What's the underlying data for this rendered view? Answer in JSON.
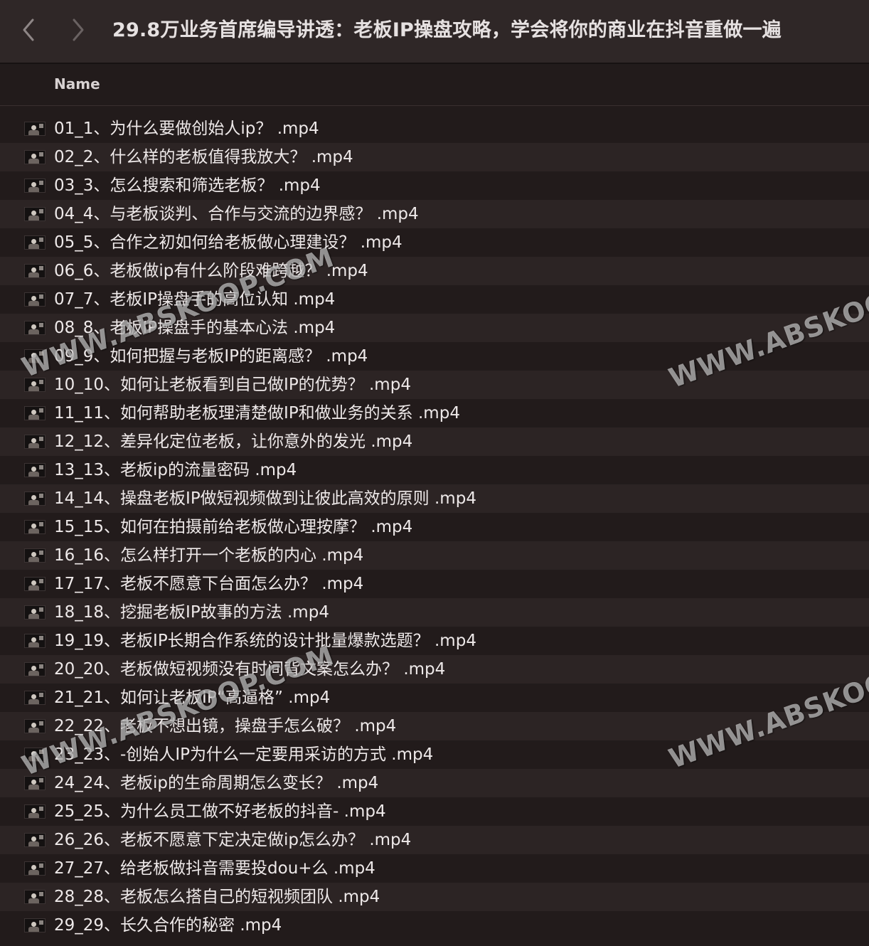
{
  "window": {
    "title": "29.8万业务首席编导讲透：老板IP操盘攻略，学会将你的商业在抖音重做一遍",
    "back_icon": "chevron-left-icon",
    "forward_icon": "chevron-right-icon"
  },
  "list": {
    "column_header": "Name",
    "files": [
      {
        "name": "01_1、为什么要做创始人ip？ .mp4",
        "icon": "video-thumbnail-icon"
      },
      {
        "name": "02_2、什么样的老板值得我放大？ .mp4",
        "icon": "video-thumbnail-icon"
      },
      {
        "name": "03_3、怎么搜索和筛选老板？ .mp4",
        "icon": "video-thumbnail-icon"
      },
      {
        "name": "04_4、与老板谈判、合作与交流的边界感？ .mp4",
        "icon": "video-thumbnail-icon"
      },
      {
        "name": "05_5、合作之初如何给老板做心理建设？ .mp4",
        "icon": "video-thumbnail-icon"
      },
      {
        "name": "06_6、老板做ip有什么阶段难跨越？ .mp4",
        "icon": "video-thumbnail-icon"
      },
      {
        "name": "07_7、老板IP操盘手的高位认知 .mp4",
        "icon": "video-thumbnail-icon"
      },
      {
        "name": "08_8、老板IP操盘手的基本心法 .mp4",
        "icon": "video-thumbnail-icon"
      },
      {
        "name": "09_9、如何把握与老板IP的距离感？ .mp4",
        "icon": "video-thumbnail-icon"
      },
      {
        "name": "10_10、如何让老板看到自己做IP的优势？ .mp4",
        "icon": "video-thumbnail-icon"
      },
      {
        "name": "11_11、如何帮助老板理清楚做IP和做业务的关系 .mp4",
        "icon": "video-thumbnail-icon"
      },
      {
        "name": "12_12、差异化定位老板，让你意外的发光 .mp4",
        "icon": "video-thumbnail-icon"
      },
      {
        "name": "13_13、老板ip的流量密码 .mp4",
        "icon": "video-thumbnail-icon"
      },
      {
        "name": "14_14、操盘老板IP做短视频做到让彼此高效的原则 .mp4",
        "icon": "video-thumbnail-icon"
      },
      {
        "name": "15_15、如何在拍摄前给老板做心理按摩？ .mp4",
        "icon": "video-thumbnail-icon"
      },
      {
        "name": "16_16、怎么样打开一个老板的内心 .mp4",
        "icon": "video-thumbnail-icon"
      },
      {
        "name": "17_17、老板不愿意下台面怎么办？ .mp4",
        "icon": "video-thumbnail-icon"
      },
      {
        "name": "18_18、挖掘老板IP故事的方法 .mp4",
        "icon": "video-thumbnail-icon"
      },
      {
        "name": "19_19、老板IP长期合作系统的设计批量爆款选题？ .mp4",
        "icon": "video-thumbnail-icon"
      },
      {
        "name": "20_20、老板做短视频没有时间背文案怎么办？ .mp4",
        "icon": "video-thumbnail-icon"
      },
      {
        "name": "21_21、如何让老板IP“高逼格” .mp4",
        "icon": "video-thumbnail-icon"
      },
      {
        "name": "22_22、老板不想出镜，操盘手怎么破？ .mp4",
        "icon": "video-thumbnail-icon"
      },
      {
        "name": "23_23、-创始人IP为什么一定要用采访的方式 .mp4",
        "icon": "video-thumbnail-icon"
      },
      {
        "name": "24_24、老板ip的生命周期怎么变长？ .mp4",
        "icon": "video-thumbnail-icon"
      },
      {
        "name": "25_25、为什么员工做不好老板的抖音- .mp4",
        "icon": "video-thumbnail-icon"
      },
      {
        "name": "26_26、老板不愿意下定决定做ip怎么办？ .mp4",
        "icon": "video-thumbnail-icon"
      },
      {
        "name": "27_27、给老板做抖音需要投dou+么 .mp4",
        "icon": "video-thumbnail-icon"
      },
      {
        "name": "28_28、老板怎么搭自己的短视频团队 .mp4",
        "icon": "video-thumbnail-icon"
      },
      {
        "name": "29_29、长久合作的秘密 .mp4",
        "icon": "video-thumbnail-icon"
      }
    ]
  },
  "watermarks": [
    {
      "text": "WWW.ABSKOOP.COM"
    },
    {
      "text": "WWW.ABSKOOP.COM"
    },
    {
      "text": "WWW.ABSKOOP.COM"
    },
    {
      "text": "WWW.ABSKOOP.COM"
    }
  ]
}
